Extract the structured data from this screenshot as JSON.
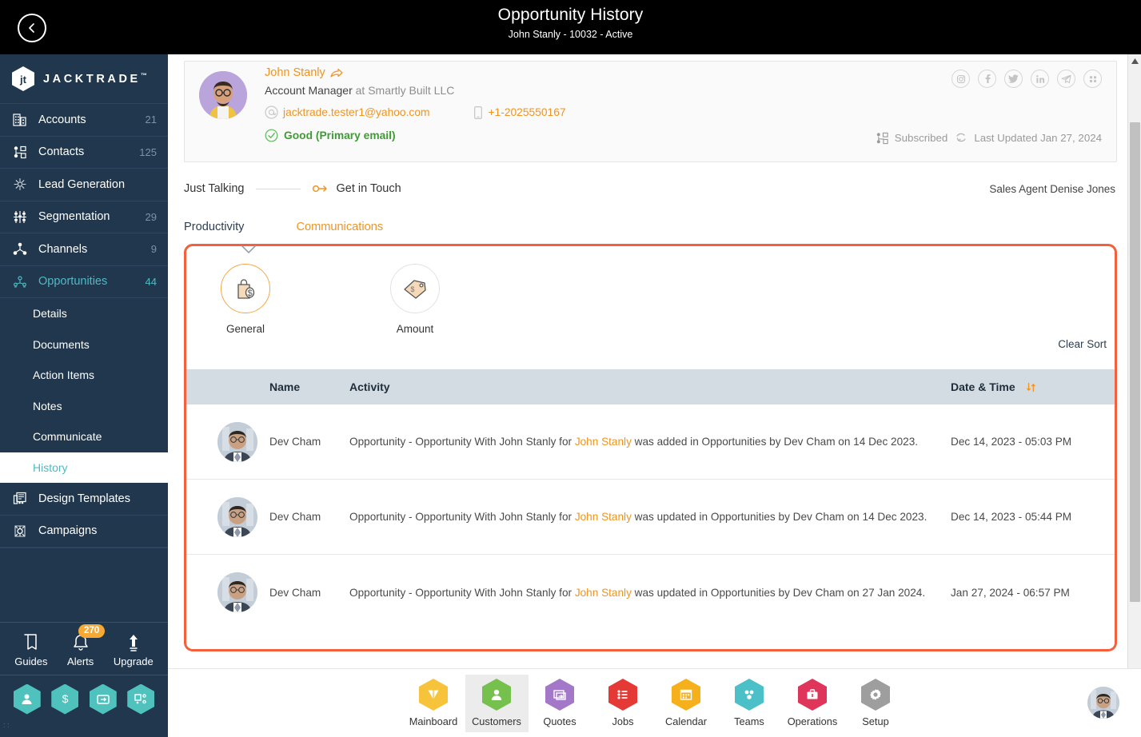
{
  "header": {
    "back_icon": "chevron-left-icon",
    "title": "Opportunity History",
    "subtitle": "John Stanly - 10032 - Active"
  },
  "sidebar": {
    "brand": {
      "name": "JACKTRADE",
      "tm": "™",
      "logo_icon": "jacktrade-hex-logo-icon"
    },
    "items": [
      {
        "label": "Accounts",
        "count": "21",
        "icon": "building-icon",
        "active": false
      },
      {
        "label": "Contacts",
        "count": "125",
        "icon": "contacts-icon",
        "active": false
      },
      {
        "label": "Lead Generation",
        "count": "",
        "icon": "lead-gen-icon",
        "active": false
      },
      {
        "label": "Segmentation",
        "count": "29",
        "icon": "segmentation-icon",
        "active": false
      },
      {
        "label": "Channels",
        "count": "9",
        "icon": "channels-icon",
        "active": false
      },
      {
        "label": "Opportunities",
        "count": "44",
        "icon": "opportunities-icon",
        "active": true
      }
    ],
    "sub_items": [
      {
        "label": "Details",
        "current": false
      },
      {
        "label": "Documents",
        "current": false
      },
      {
        "label": "Action Items",
        "current": false
      },
      {
        "label": "Notes",
        "current": false
      },
      {
        "label": "Communicate",
        "current": false
      },
      {
        "label": "History",
        "current": true
      }
    ],
    "items_after": [
      {
        "label": "Design Templates",
        "count": "",
        "icon": "design-templates-icon"
      },
      {
        "label": "Campaigns",
        "count": "",
        "icon": "campaigns-icon"
      }
    ],
    "quick": [
      {
        "label": "Guides",
        "icon": "guides-book-icon",
        "badge": ""
      },
      {
        "label": "Alerts",
        "icon": "bell-icon",
        "badge": "270"
      },
      {
        "label": "Upgrade",
        "icon": "upgrade-arrow-icon",
        "badge": ""
      }
    ],
    "hex_shortcuts": [
      {
        "icon": "person-hex-icon"
      },
      {
        "icon": "dollar-hex-icon"
      },
      {
        "icon": "payment-hex-icon"
      },
      {
        "icon": "workflow-hex-icon"
      }
    ],
    "footer_marks": ":\n:"
  },
  "contact_card": {
    "avatar": "contact-avatar",
    "name": "John Stanly",
    "name_action_icon": "share-arrow-icon",
    "role": "Account Manager",
    "role_company": " at Smartly Built LLC",
    "email_icon": "at-sign-icon",
    "email": "jacktrade.tester1@yahoo.com",
    "phone_icon": "mobile-phone-icon",
    "phone": "+1-2025550167",
    "status_icon": "check-circle-icon",
    "status": "Good (Primary email)",
    "socials": [
      {
        "icon": "instagram-icon",
        "glyph": "◙"
      },
      {
        "icon": "facebook-icon",
        "glyph": "f"
      },
      {
        "icon": "twitter-icon",
        "glyph": "t"
      },
      {
        "icon": "linkedin-icon",
        "glyph": "in"
      },
      {
        "icon": "telegram-icon",
        "glyph": "➤"
      },
      {
        "icon": "apps-grid-icon",
        "glyph": "▦"
      }
    ],
    "subscribed_icon": "subscribed-contact-icon",
    "subscribed": "Subscribed",
    "refresh_icon": "refresh-icon",
    "last_updated": "Last Updated Jan 27, 2024"
  },
  "stage": {
    "from": "Just Talking",
    "arrow_icon": "stage-arrow-icon",
    "to": "Get in Touch",
    "sales_agent": "Sales Agent Denise Jones"
  },
  "tabs": [
    {
      "label": "Productivity",
      "active": false
    },
    {
      "label": "Communications",
      "active": true
    }
  ],
  "panel": {
    "border_color": "#f4603e",
    "icon_cards": [
      {
        "label": "General",
        "icon": "shopping-bag-dollar-icon",
        "selected": true
      },
      {
        "label": "Amount",
        "icon": "price-tag-icon",
        "selected": false
      }
    ],
    "clear_sort": "Clear Sort",
    "table": {
      "columns": [
        "",
        "Name",
        "Activity",
        "Date & Time"
      ],
      "sort_icon": "sort-updown-icon",
      "rows": [
        {
          "avatar": "row-avatar",
          "name": "Dev Cham",
          "activity_pre": "Opportunity - Opportunity With John Stanly for ",
          "activity_link": "John Stanly",
          "activity_post": " was added in Opportunities by Dev Cham on 14 Dec 2023.",
          "datetime": "Dec 14, 2023 - 05:03 PM"
        },
        {
          "avatar": "row-avatar",
          "name": "Dev Cham",
          "activity_pre": "Opportunity - Opportunity With John Stanly for ",
          "activity_link": "John Stanly",
          "activity_post": " was updated in Opportunities by Dev Cham on 14 Dec 2023.",
          "datetime": "Dec 14, 2023 - 05:44 PM"
        },
        {
          "avatar": "row-avatar",
          "name": "Dev Cham",
          "activity_pre": "Opportunity - Opportunity With John Stanly for ",
          "activity_link": "John Stanly",
          "activity_post": " was updated in Opportunities by Dev Cham on 27 Jan 2024.",
          "datetime": "Jan 27, 2024 - 06:57 PM"
        }
      ]
    }
  },
  "bottom_nav": {
    "items": [
      {
        "label": "Mainboard",
        "icon": "mainboard-icon",
        "color": "#f7c33a",
        "active": false
      },
      {
        "label": "Customers",
        "icon": "customers-icon",
        "color": "#76c04e",
        "active": true
      },
      {
        "label": "Quotes",
        "icon": "quotes-icon",
        "color": "#a378c9",
        "active": false
      },
      {
        "label": "Jobs",
        "icon": "jobs-icon",
        "color": "#e53935",
        "active": false
      },
      {
        "label": "Calendar",
        "icon": "calendar-icon",
        "color": "#f5b01c",
        "active": false
      },
      {
        "label": "Teams",
        "icon": "teams-icon",
        "color": "#4bc0c8",
        "active": false
      },
      {
        "label": "Operations",
        "icon": "operations-icon",
        "color": "#e0355a",
        "active": false
      },
      {
        "label": "Setup",
        "icon": "setup-gear-icon",
        "color": "#9e9e9e",
        "active": false
      }
    ],
    "avatar": "user-avatar"
  },
  "scrollbar": {
    "up_icon": "scroll-up-arrow-icon",
    "down_icon": "scroll-down-arrow-icon"
  }
}
